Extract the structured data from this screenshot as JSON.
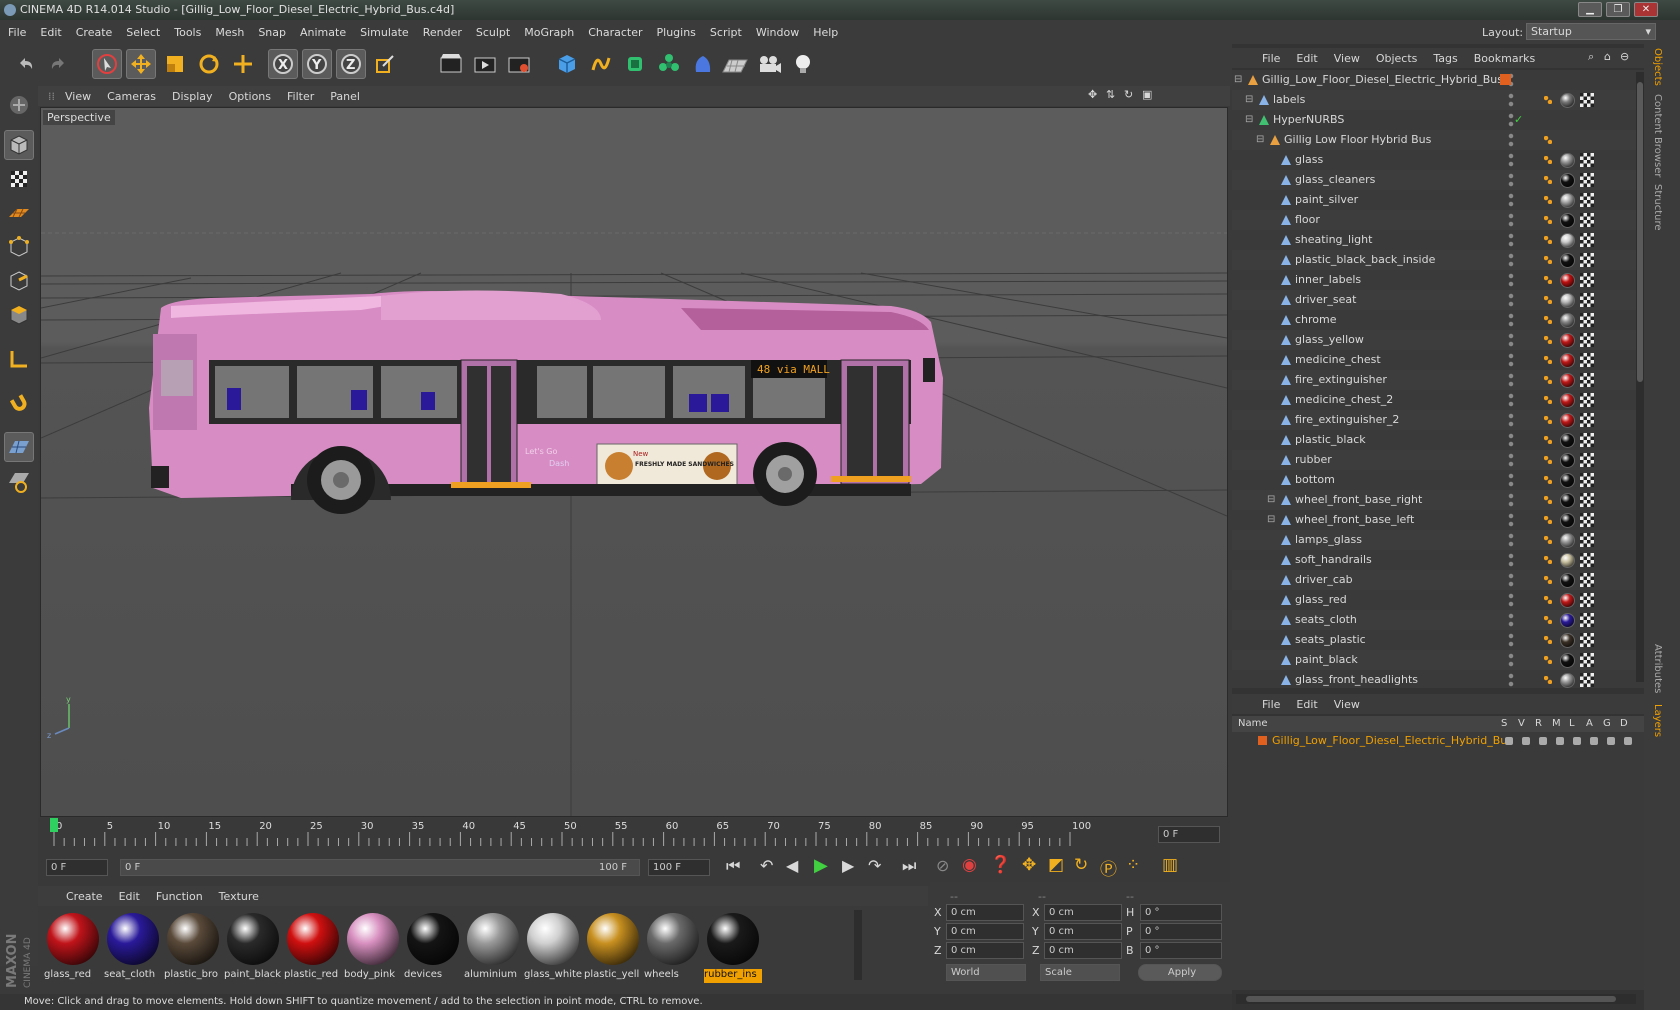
{
  "window": {
    "title": "CINEMA 4D R14.014 Studio - [Gillig_Low_Floor_Diesel_Electric_Hybrid_Bus.c4d]"
  },
  "menubar": {
    "items": [
      "File",
      "Edit",
      "Create",
      "Select",
      "Tools",
      "Mesh",
      "Snap",
      "Animate",
      "Simulate",
      "Render",
      "Sculpt",
      "MoGraph",
      "Character",
      "Plugins",
      "Script",
      "Window",
      "Help"
    ]
  },
  "layout": {
    "label": "Layout:",
    "value": "Startup"
  },
  "viewport": {
    "menu": [
      "View",
      "Cameras",
      "Display",
      "Options",
      "Filter",
      "Panel"
    ],
    "camera_label": "Perspective",
    "bus_sign": "48 via MALL",
    "ad_title": "FRESHLY MADE SANDWICHES",
    "ad_new": "New",
    "side_text": "Let's Go",
    "side_text2": "Dash"
  },
  "timeline": {
    "ticks": [
      "0",
      "5",
      "10",
      "15",
      "20",
      "25",
      "30",
      "35",
      "40",
      "45",
      "50",
      "55",
      "60",
      "65",
      "70",
      "75",
      "80",
      "85",
      "90",
      "95",
      "100"
    ],
    "current_frame": "0 F",
    "start_field": "0 F",
    "range_start": "0 F",
    "range_end": "100 F",
    "end_field": "100 F"
  },
  "materials": {
    "menu": [
      "Create",
      "Edit",
      "Function",
      "Texture"
    ],
    "items": [
      {
        "name": "glass_red",
        "color": "#c0141a"
      },
      {
        "name": "seat_cloth",
        "color": "#2a1a9a"
      },
      {
        "name": "plastic_bro",
        "color": "#5a4a3a"
      },
      {
        "name": "paint_black",
        "color": "#2a2a2a"
      },
      {
        "name": "plastic_red",
        "color": "#d01010"
      },
      {
        "name": "body_pink",
        "color": "#d890c0"
      },
      {
        "name": "devices",
        "color": "#141414"
      },
      {
        "name": "aluminium",
        "color": "#9a9a9a"
      },
      {
        "name": "glass_white",
        "color": "#d0d0d0"
      },
      {
        "name": "plastic_yell",
        "color": "#c89020"
      },
      {
        "name": "wheels",
        "color": "#6a6a6a"
      },
      {
        "name": "rubber_ins",
        "color": "#1a1a1a"
      }
    ],
    "selected_index": 11
  },
  "coords": {
    "header": [
      "--",
      "--",
      "--"
    ],
    "rows": [
      {
        "a": "X",
        "av": "0 cm",
        "b": "X",
        "bv": "0 cm",
        "c": "H",
        "cv": "0 °"
      },
      {
        "a": "Y",
        "av": "0 cm",
        "b": "Y",
        "bv": "0 cm",
        "c": "P",
        "cv": "0 °"
      },
      {
        "a": "Z",
        "av": "0 cm",
        "b": "Z",
        "bv": "0 cm",
        "c": "B",
        "cv": "0 °"
      }
    ],
    "world": "World",
    "scale": "Scale",
    "apply": "Apply"
  },
  "status": {
    "text": "Move: Click and drag to move elements. Hold down SHIFT to quantize movement / add to the selection in point mode, CTRL to remove."
  },
  "objects_panel": {
    "menu": [
      "File",
      "Edit",
      "View",
      "Objects",
      "Tags",
      "Bookmarks"
    ],
    "rows": [
      {
        "name": "Gillig_Low_Floor_Diesel_Electric_Hybrid_Bus",
        "indent": 0,
        "type": "null",
        "ball": ""
      },
      {
        "name": "labels",
        "indent": 1,
        "type": "poly",
        "ball": "#7a7a7a"
      },
      {
        "name": "HyperNURBS",
        "indent": 1,
        "type": "nurbs",
        "ball": ""
      },
      {
        "name": "Gillig Low Floor Hybrid Bus",
        "indent": 2,
        "type": "null",
        "ball": ""
      },
      {
        "name": "glass",
        "indent": 3,
        "type": "poly",
        "ball": "#999999"
      },
      {
        "name": "glass_cleaners",
        "indent": 3,
        "type": "poly",
        "ball": "#111111"
      },
      {
        "name": "paint_silver",
        "indent": 3,
        "type": "poly",
        "ball": "#aaaaaa"
      },
      {
        "name": "floor",
        "indent": 3,
        "type": "poly",
        "ball": "#111111"
      },
      {
        "name": "sheating_light",
        "indent": 3,
        "type": "poly",
        "ball": "#cccccc"
      },
      {
        "name": "plastic_black_back_inside",
        "indent": 3,
        "type": "poly",
        "ball": "#111111"
      },
      {
        "name": "inner_labels",
        "indent": 3,
        "type": "poly",
        "ball": "#c01010"
      },
      {
        "name": "driver_seat",
        "indent": 3,
        "type": "poly",
        "ball": "#bbbbbb"
      },
      {
        "name": "chrome",
        "indent": 3,
        "type": "poly",
        "ball": "#888888"
      },
      {
        "name": "glass_yellow",
        "indent": 3,
        "type": "poly",
        "ball": "#c01818"
      },
      {
        "name": "medicine_chest",
        "indent": 3,
        "type": "poly",
        "ball": "#c01818"
      },
      {
        "name": "fire_extinguisher",
        "indent": 3,
        "type": "poly",
        "ball": "#c01818"
      },
      {
        "name": "medicine_chest_2",
        "indent": 3,
        "type": "poly",
        "ball": "#c01818"
      },
      {
        "name": "fire_extinguisher_2",
        "indent": 3,
        "type": "poly",
        "ball": "#c01818"
      },
      {
        "name": "plastic_black",
        "indent": 3,
        "type": "poly",
        "ball": "#111111"
      },
      {
        "name": "rubber",
        "indent": 3,
        "type": "poly",
        "ball": "#111111"
      },
      {
        "name": "bottom",
        "indent": 3,
        "type": "poly",
        "ball": "#111111"
      },
      {
        "name": "wheel_front_base_right",
        "indent": 3,
        "type": "poly",
        "ball": "#111111",
        "expand": true
      },
      {
        "name": "wheel_front_base_left",
        "indent": 3,
        "type": "poly",
        "ball": "#111111",
        "expand": true
      },
      {
        "name": "lamps_glass",
        "indent": 3,
        "type": "poly",
        "ball": "#999999"
      },
      {
        "name": "soft_handrails",
        "indent": 3,
        "type": "poly",
        "ball": "#c8c0a0"
      },
      {
        "name": "driver_cab",
        "indent": 3,
        "type": "poly",
        "ball": "#111111"
      },
      {
        "name": "glass_red",
        "indent": 3,
        "type": "poly",
        "ball": "#c01818"
      },
      {
        "name": "seats_cloth",
        "indent": 3,
        "type": "poly",
        "ball": "#2a1a9a"
      },
      {
        "name": "seats_plastic",
        "indent": 3,
        "type": "poly",
        "ball": "#3a3026"
      },
      {
        "name": "paint_black",
        "indent": 3,
        "type": "poly",
        "ball": "#111111"
      },
      {
        "name": "glass_front_headlights",
        "indent": 3,
        "type": "poly",
        "ball": "#999999"
      }
    ]
  },
  "layers_panel": {
    "menu": [
      "File",
      "Edit",
      "View"
    ],
    "columns": [
      "Name",
      "S",
      "V",
      "R",
      "M",
      "L",
      "A",
      "G",
      "D"
    ],
    "rows": [
      {
        "name": "Gillig_Low_Floor_Diesel_Electric_Hybrid_Bus"
      }
    ]
  },
  "side_tabs": [
    "Objects",
    "Content Browser",
    "Structure",
    "Attributes",
    "Layers"
  ],
  "brand": {
    "line1": "MAXON",
    "line2": "CINEMA 4D"
  },
  "colors": {
    "accent": "#f0a000",
    "selected_text": "#f0a000",
    "bus_pink": "#d88cc4"
  }
}
